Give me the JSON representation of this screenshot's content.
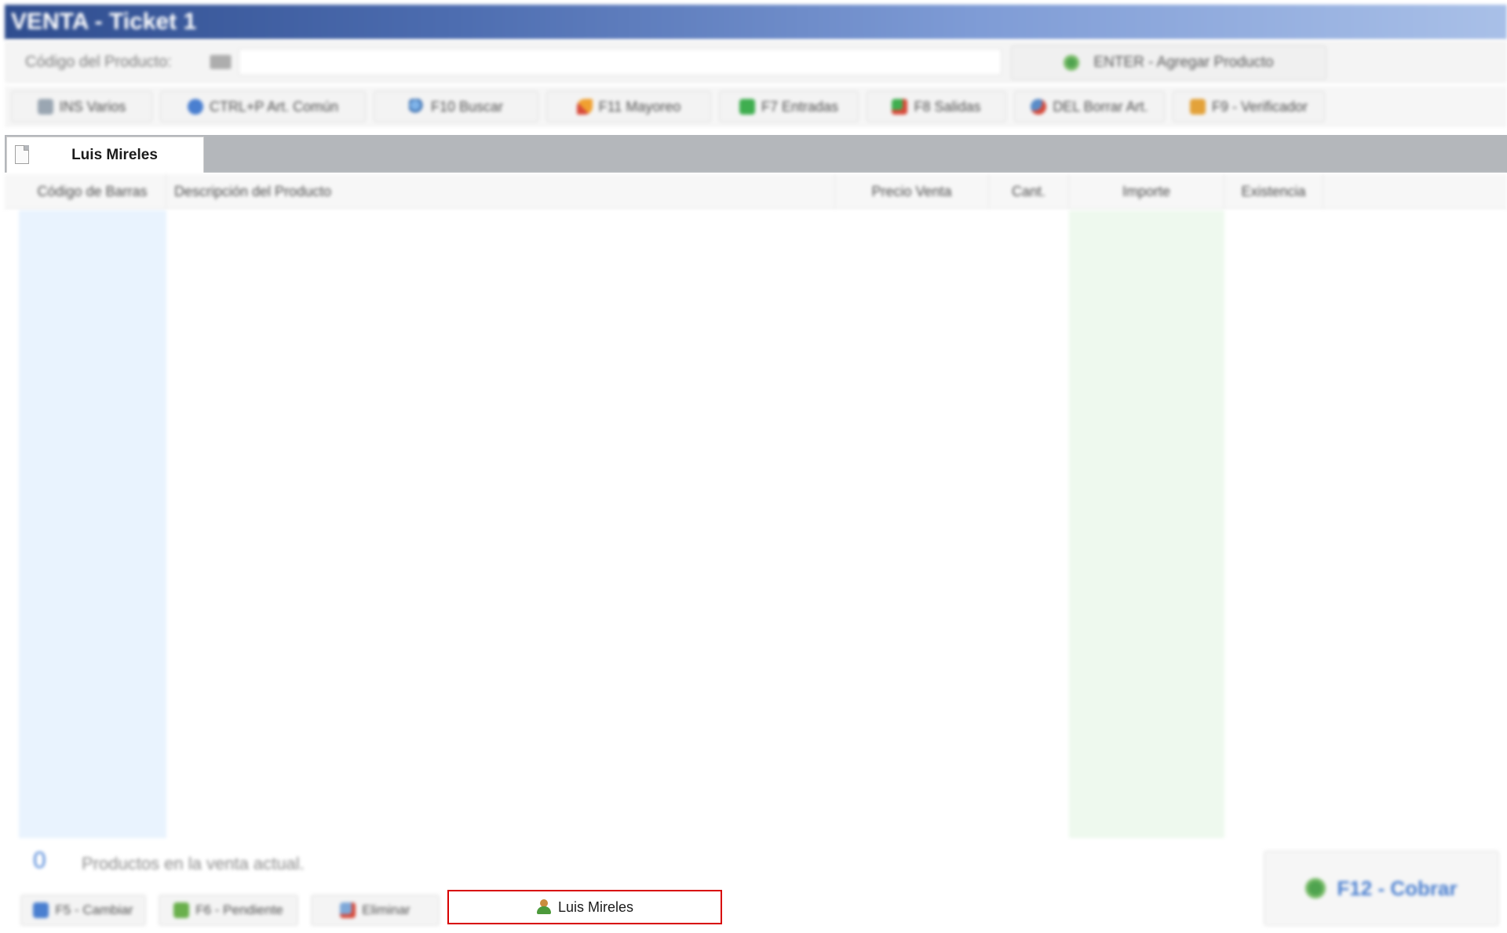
{
  "window": {
    "title": "VENTA - Ticket 1"
  },
  "product_entry": {
    "label": "Código del Producto:",
    "input_value": "",
    "add_button_label": "ENTER - Agregar Producto"
  },
  "toolbar": {
    "buttons": [
      {
        "label": "INS Varios",
        "icon": "basket-icon"
      },
      {
        "label": "CTRL+P Art. Común",
        "icon": "common-item-icon"
      },
      {
        "label": "F10 Buscar",
        "icon": "search-icon"
      },
      {
        "label": "F11 Mayoreo",
        "icon": "rocket-icon"
      },
      {
        "label": "F7 Entradas",
        "icon": "cash-in-icon"
      },
      {
        "label": "F8 Salidas",
        "icon": "cash-out-icon"
      },
      {
        "label": "DEL Borrar Art.",
        "icon": "delete-item-icon"
      },
      {
        "label": "F9 - Verificador",
        "icon": "price-checker-icon"
      }
    ]
  },
  "ticket_tabs": [
    {
      "label": "Luis Mireles",
      "icon": "document-icon",
      "active": true
    }
  ],
  "grid": {
    "columns": [
      "Código de Barras",
      "Descripción del Producto",
      "Precio Venta",
      "Cant.",
      "Importe",
      "Existencia"
    ],
    "rows": []
  },
  "footer": {
    "product_count": "0",
    "product_count_label": "Productos en la venta actual.",
    "buttons": [
      {
        "label": "F5 - Cambiar",
        "icon": "change-ticket-icon"
      },
      {
        "label": "F6 - Pendiente",
        "icon": "pending-icon"
      },
      {
        "label": "Eliminar",
        "icon": "delete-ticket-icon"
      }
    ],
    "customer_button_label": "Luis Mireles",
    "charge_button_label": "F12 - Cobrar"
  },
  "colors": {
    "title_bar_start": "#2f4d8f",
    "title_bar_end": "#a9c0e8",
    "highlight_border": "#d80000",
    "accent_blue": "#4a7fd0",
    "barcode_column_bg": "#e9f3fe",
    "importe_column_bg": "#eef9ee"
  }
}
